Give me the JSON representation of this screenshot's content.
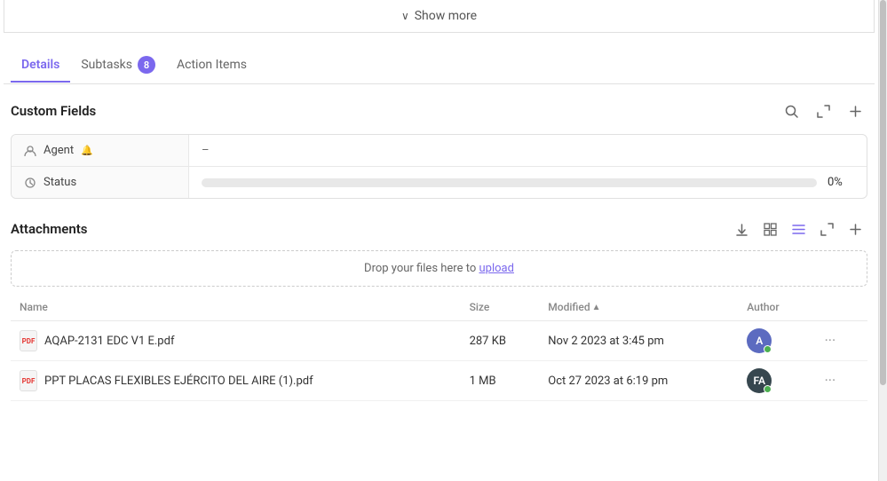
{
  "show_more": {
    "label": "Show more",
    "chevron": "∨"
  },
  "tabs": [
    {
      "id": "details",
      "label": "Details",
      "active": true,
      "badge": null
    },
    {
      "id": "subtasks",
      "label": "Subtasks",
      "active": false,
      "badge": "8"
    },
    {
      "id": "action-items",
      "label": "Action Items",
      "active": false,
      "badge": null
    }
  ],
  "custom_fields": {
    "title": "Custom Fields",
    "fields": [
      {
        "id": "agent",
        "icon": "👤",
        "label": "Agent",
        "value": "–"
      },
      {
        "id": "status",
        "icon": "⚙",
        "label": "Status",
        "value": "0%",
        "progress": 0
      }
    ]
  },
  "attachments": {
    "title": "Attachments",
    "drop_text": "Drop your files here to",
    "upload_link": "upload",
    "columns": [
      {
        "id": "name",
        "label": "Name"
      },
      {
        "id": "size",
        "label": "Size"
      },
      {
        "id": "modified",
        "label": "Modified",
        "sort": "asc"
      },
      {
        "id": "author",
        "label": "Author"
      }
    ],
    "files": [
      {
        "id": 1,
        "name": "AQAP-2131 EDC V1 E.pdf",
        "size": "287 KB",
        "modified": "Nov 2 2023 at 3:45 pm",
        "author_initials": "A",
        "author_color": "#5c6bc0"
      },
      {
        "id": 2,
        "name": "PPT PLACAS FLEXIBLES EJÉRCITO DEL AIRE (1).pdf",
        "size": "1 MB",
        "modified": "Oct 27 2023 at 6:19 pm",
        "author_initials": "FA",
        "author_color": "#37474f"
      }
    ]
  },
  "icons": {
    "search": "🔍",
    "expand": "⤢",
    "plus": "+",
    "download": "⬇",
    "grid": "⊞",
    "list": "≡",
    "expand2": "⤢",
    "dots": "···"
  }
}
